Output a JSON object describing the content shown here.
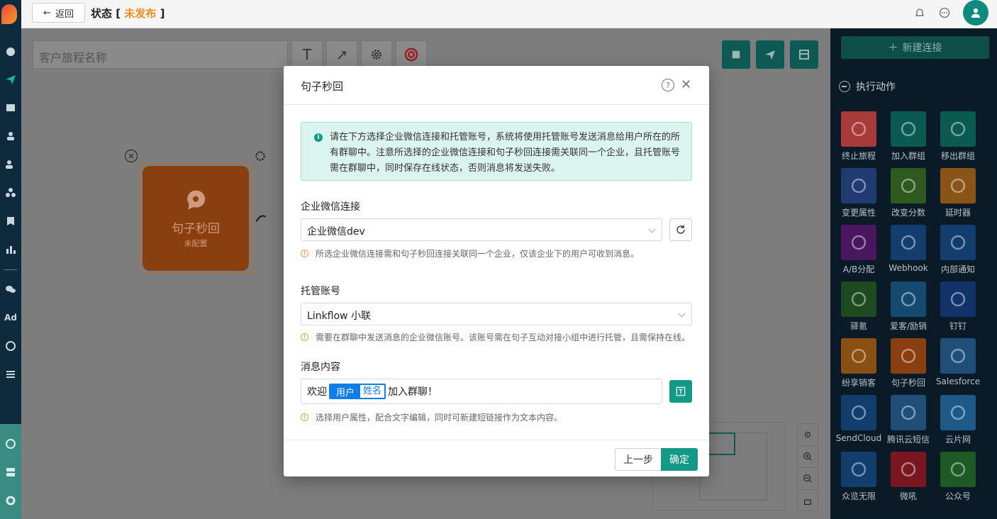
{
  "header": {
    "back_label": "返回",
    "title_prefix": "状态 [",
    "status": "未发布",
    "title_suffix": "]"
  },
  "canvas": {
    "journey_placeholder": "客户旅程名称",
    "node": {
      "title": "句子秒回",
      "subtitle": "未配置"
    }
  },
  "rightpanel": {
    "new_connection_label": "新建连接",
    "section_title": "执行动作",
    "tiles": [
      {
        "label": "终止旅程",
        "color": "#a83a3a"
      },
      {
        "label": "加入群组",
        "color": "#0b5a52"
      },
      {
        "label": "移出群组",
        "color": "#0b5a52"
      },
      {
        "label": "变更属性",
        "color": "#1f3b70"
      },
      {
        "label": "改变分数",
        "color": "#2e5a1f"
      },
      {
        "label": "延时器",
        "color": "#8a5416"
      },
      {
        "label": "A/B分配",
        "color": "#4a1660"
      },
      {
        "label": "Webhook",
        "color": "#123e6e"
      },
      {
        "label": "内部通知",
        "color": "#123e6e"
      },
      {
        "label": "驿氪",
        "color": "#1e4a20"
      },
      {
        "label": "爱客/励销",
        "color": "#144a70"
      },
      {
        "label": "钉钉",
        "color": "#12336a"
      },
      {
        "label": "纷享销客",
        "color": "#8a4f12"
      },
      {
        "label": "句子秒回",
        "color": "#8a3f10"
      },
      {
        "label": "Salesforce",
        "color": "#1f4f78"
      },
      {
        "label": "SendCloud",
        "color": "#123e6e"
      },
      {
        "label": "腾讯云短信",
        "color": "#1f4f78"
      },
      {
        "label": "云片网",
        "color": "#1d5a8a"
      },
      {
        "label": "众览无限",
        "color": "#123e6e"
      },
      {
        "label": "微吼",
        "color": "#7a1620"
      },
      {
        "label": "公众号",
        "color": "#1e5a24"
      }
    ]
  },
  "modal": {
    "title": "句子秒回",
    "notice": "请在下方选择企业微信连接和托管账号，系统将使用托管账号发送消息给用户所在的所有群聊中。注意所选择的企业微信连接和句子秒回连接需关联同一个企业，且托管账号需在群聊中，同时保存在线状态，否则消息将发送失败。",
    "wecom_label": "企业微信连接",
    "wecom_value": "企业微信dev",
    "wecom_hint": "所选企业微信连接需和句子秒回连接关联同一个企业，仅该企业下的用户可收到消息。",
    "account_label": "托管账号",
    "account_value": "Linkflow 小联",
    "account_hint": "需要在群聊中发送消息的企业微信账号。该账号需在句子互动对接小组中进行托管，且需保持在线。",
    "message_label": "消息内容",
    "message_prefix": "欢迎",
    "tag_key": "用户",
    "tag_value": "姓名",
    "message_suffix": "加入群聊！",
    "message_hint": "选择用户属性，配合文字编辑，同时可新建短链接作为文本内容。",
    "prev_label": "上一步",
    "ok_label": "确定"
  }
}
